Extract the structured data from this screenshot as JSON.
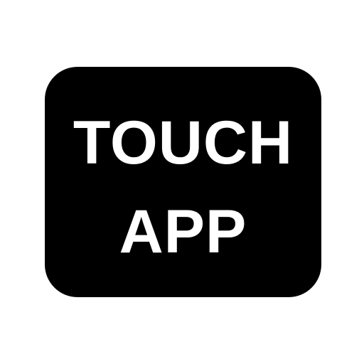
{
  "icon": {
    "name": "touch-app-icon",
    "lines": [
      "TOUCH",
      "APP"
    ],
    "colors": {
      "background": "#ffffff",
      "badge": "#000000",
      "text": "#ffffff"
    }
  }
}
